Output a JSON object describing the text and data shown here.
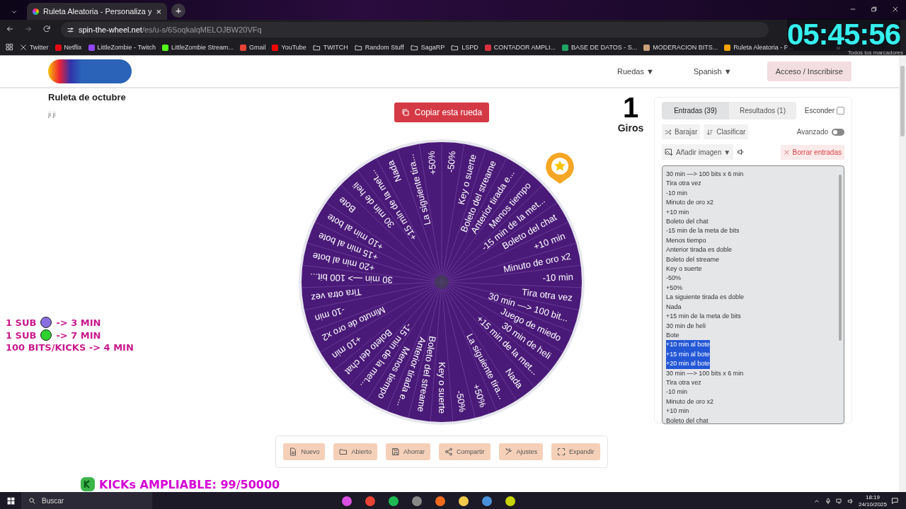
{
  "browser": {
    "tab": {
      "title": "Ruleta Aleatoria - Personaliza y",
      "close": "×",
      "new": "+"
    },
    "url_host": "spin-the-wheel.net",
    "url_path": "/es/u-s/6SoqkalqMELOJBW20VFq",
    "bookmarks": [
      {
        "kind": "x",
        "label": "Twitter"
      },
      {
        "kind": "site",
        "label": "Netflix",
        "color": "#e50914"
      },
      {
        "kind": "site",
        "label": "LittleZombie - Twitch",
        "color": "#9146ff"
      },
      {
        "kind": "site",
        "label": "LittleZombie Stream...",
        "color": "#53fc18"
      },
      {
        "kind": "site",
        "label": "Gmail",
        "color": "#ea4335"
      },
      {
        "kind": "site",
        "label": "YouTube",
        "color": "#ff0000"
      },
      {
        "kind": "folder",
        "label": "TWITCH"
      },
      {
        "kind": "folder",
        "label": "Random Stuff"
      },
      {
        "kind": "folder",
        "label": "SagaRP"
      },
      {
        "kind": "folder",
        "label": "LSPD"
      },
      {
        "kind": "site",
        "label": "CONTADOR AMPLI...",
        "color": "#d9303f"
      },
      {
        "kind": "site",
        "label": "BASE DE DATOS - S...",
        "color": "#1fa463"
      },
      {
        "kind": "site",
        "label": "MODERACION BITS...",
        "color": "#c9a27a"
      },
      {
        "kind": "site",
        "label": "Ruleta Aleatoria - P...",
        "color": "#f4a300"
      }
    ],
    "bookmarks_overflow": "»",
    "all_bookmarks": "Todos los marcadores"
  },
  "stream_overlay": {
    "clock": "05:45:56",
    "rates": [
      {
        "kind": "dot",
        "label": "1 SUB",
        "color": "#8a6fe0",
        "value": "-> 3 MIN"
      },
      {
        "kind": "dot",
        "label": "1 SUB",
        "color": "#2ed12e",
        "value": "-> 7 MIN"
      },
      {
        "kind": "plain",
        "label": "100 BITS/KICKS -> 4 MIN"
      }
    ],
    "kicks": "KICKs AMPLIABLE: 99/50000"
  },
  "site": {
    "nav": [
      "Ruedas ▼",
      "Spanish ▼"
    ],
    "login": "Acceso / Inscribirse"
  },
  "wheel_info": {
    "title": "Ruleta de octubre",
    "description": "ji ji"
  },
  "copy_button": "Copiar esta rueda",
  "wheel": {
    "segments": [
      "-50%",
      "Key o suerte",
      "Boleto del streame",
      "Anterior tirada e...",
      "Menos tiempo",
      "-15 min de la met...",
      "Boleto del chat",
      "+10 min",
      "Minuto de oro x2",
      "-10 min",
      "Tira otra vez",
      "30 min —> 100 bit...",
      "Juego de miedo",
      "30 min de heli",
      "+15 min de la met...",
      "Nada",
      "La siguiente tira...",
      "+50%",
      "-50%",
      "Key o suerte",
      "Boleto del streame",
      "Anterior tirada e...",
      "Menos tiempo",
      "-15 min de la met...",
      "Boleto del chat",
      "+10 min",
      "Minuto de oro x2",
      "-10 min",
      "Tira otra vez",
      "30 min —> 100 bit...",
      "+20 min al bote",
      "+15 min al bote",
      "+10 min al bote",
      "Bote",
      "30 min de heli",
      "+15 min de la met...",
      "Nada",
      "La siguiente tira...",
      "+50%"
    ]
  },
  "toolbar": [
    {
      "kind": "file",
      "label": "Nuevo"
    },
    {
      "kind": "folder",
      "label": "Abierto"
    },
    {
      "kind": "save",
      "label": "Ahorrar"
    },
    {
      "kind": "share",
      "label": "Compartir"
    },
    {
      "kind": "tools",
      "label": "Ajustes"
    },
    {
      "kind": "expand",
      "label": "Expandir"
    }
  ],
  "spins": {
    "count": "1",
    "label": "Giros"
  },
  "panel": {
    "tabs": [
      {
        "label": "Entradas (39)",
        "selected": true
      },
      {
        "label": "Resultados (1)",
        "selected": false
      }
    ],
    "hide": {
      "label": "Esconder",
      "checked": false
    },
    "shuffle": "Barajar",
    "sort": "Clasificar",
    "advanced": {
      "label": "Avanzado",
      "on": false
    },
    "add_image": "Añadir imagen ▼",
    "clear": "Borrar entradas",
    "entries": [
      {
        "text": "30 min —> 100 bits x 6 min",
        "highlighted": false
      },
      {
        "text": "Tira otra vez",
        "highlighted": false
      },
      {
        "text": "-10 min",
        "highlighted": false
      },
      {
        "text": "Minuto de oro x2",
        "highlighted": false
      },
      {
        "text": "+10 min",
        "highlighted": false
      },
      {
        "text": "Boleto del chat",
        "highlighted": false
      },
      {
        "text": "-15 min de la meta de bits",
        "highlighted": false
      },
      {
        "text": "Menos tiempo",
        "highlighted": false
      },
      {
        "text": "Anterior tirada es doble",
        "highlighted": false
      },
      {
        "text": "Boleto del streame",
        "highlighted": false
      },
      {
        "text": "Key o suerte",
        "highlighted": false
      },
      {
        "text": "-50%",
        "highlighted": false
      },
      {
        "text": "+50%",
        "highlighted": false
      },
      {
        "text": "La siguiente tirada es doble",
        "highlighted": false
      },
      {
        "text": "Nada",
        "highlighted": false
      },
      {
        "text": "+15 min de la meta de bits",
        "highlighted": false
      },
      {
        "text": "30 min de heli",
        "highlighted": false
      },
      {
        "text": "Bote",
        "highlighted": false
      },
      {
        "text": "+10 min al bote",
        "highlighted": true
      },
      {
        "text": "+15 min al bote",
        "highlighted": true
      },
      {
        "text": "+20 min al bote",
        "highlighted": true
      },
      {
        "text": "30 min —> 100 bits x 6 min",
        "highlighted": false
      },
      {
        "text": "Tira otra vez",
        "highlighted": false
      },
      {
        "text": "-10 min",
        "highlighted": false
      },
      {
        "text": "Minuto de oro x2",
        "highlighted": false
      },
      {
        "text": "+10 min",
        "highlighted": false
      },
      {
        "text": "Boleto del chat",
        "highlighted": false
      }
    ]
  },
  "taskbar": {
    "search": "Buscar",
    "time": "18:19",
    "date": "24/10/2025"
  }
}
